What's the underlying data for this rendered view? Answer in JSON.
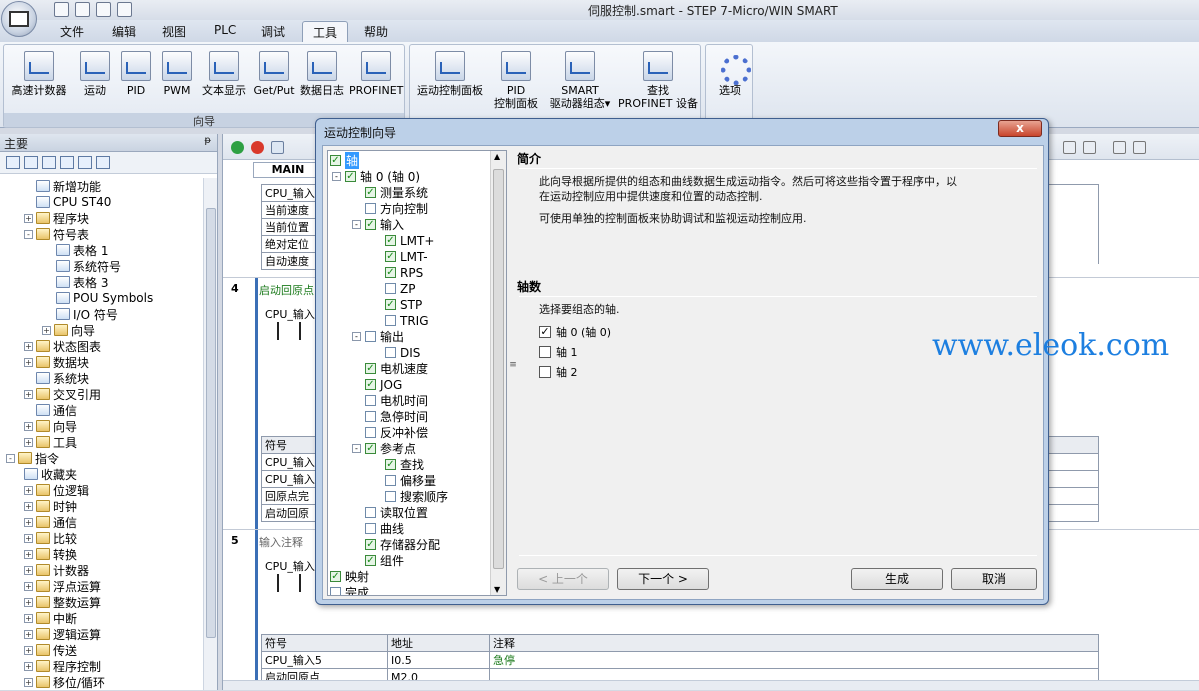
{
  "window": {
    "title": "伺服控制.smart - STEP 7-Micro/WIN SMART"
  },
  "menu": [
    "文件",
    "编辑",
    "视图",
    "PLC",
    "调试",
    "工具",
    "帮助"
  ],
  "ribbon": {
    "group_wizards_label": "向导",
    "wizards": [
      "高速计数器",
      "运动",
      "PID",
      "PWM",
      "文本显示",
      "Get/Put",
      "数据日志",
      "PROFINET"
    ],
    "tools": [
      {
        "l1": "运动控制面板",
        "l2": ""
      },
      {
        "l1": "PID",
        "l2": "控制面板"
      },
      {
        "l1": "SMART",
        "l2": "驱动器组态▾"
      },
      {
        "l1": "查找",
        "l2": "PROFINET 设备"
      }
    ],
    "options": "选项"
  },
  "left_pane": {
    "title": "主要",
    "tree": [
      {
        "label": "新增功能",
        "indent": 36,
        "pm": ""
      },
      {
        "label": "CPU ST40",
        "indent": 36,
        "pm": ""
      },
      {
        "label": "程序块",
        "indent": 24,
        "pm": "+"
      },
      {
        "label": "符号表",
        "indent": 24,
        "pm": "-"
      },
      {
        "label": "表格 1",
        "indent": 56,
        "pm": ""
      },
      {
        "label": "系统符号",
        "indent": 56,
        "pm": ""
      },
      {
        "label": "表格 3",
        "indent": 56,
        "pm": ""
      },
      {
        "label": "POU Symbols",
        "indent": 56,
        "pm": ""
      },
      {
        "label": "I/O 符号",
        "indent": 56,
        "pm": ""
      },
      {
        "label": "向导",
        "indent": 42,
        "pm": "+"
      },
      {
        "label": "状态图表",
        "indent": 24,
        "pm": "+"
      },
      {
        "label": "数据块",
        "indent": 24,
        "pm": "+"
      },
      {
        "label": "系统块",
        "indent": 36,
        "pm": ""
      },
      {
        "label": "交叉引用",
        "indent": 24,
        "pm": "+"
      },
      {
        "label": "通信",
        "indent": 36,
        "pm": ""
      },
      {
        "label": "向导",
        "indent": 24,
        "pm": "+"
      },
      {
        "label": "工具",
        "indent": 24,
        "pm": "+"
      },
      {
        "label": "指令",
        "indent": 6,
        "pm": "-"
      },
      {
        "label": "收藏夹",
        "indent": 24,
        "pm": ""
      },
      {
        "label": "位逻辑",
        "indent": 24,
        "pm": "+"
      },
      {
        "label": "时钟",
        "indent": 24,
        "pm": "+"
      },
      {
        "label": "通信",
        "indent": 24,
        "pm": "+"
      },
      {
        "label": "比较",
        "indent": 24,
        "pm": "+"
      },
      {
        "label": "转换",
        "indent": 24,
        "pm": "+"
      },
      {
        "label": "计数器",
        "indent": 24,
        "pm": "+"
      },
      {
        "label": "浮点运算",
        "indent": 24,
        "pm": "+"
      },
      {
        "label": "整数运算",
        "indent": 24,
        "pm": "+"
      },
      {
        "label": "中断",
        "indent": 24,
        "pm": "+"
      },
      {
        "label": "逻辑运算",
        "indent": 24,
        "pm": "+"
      },
      {
        "label": "传送",
        "indent": 24,
        "pm": "+"
      },
      {
        "label": "程序控制",
        "indent": 24,
        "pm": "+"
      },
      {
        "label": "移位/循环",
        "indent": 24,
        "pm": "+"
      }
    ]
  },
  "editor": {
    "tab": "MAIN",
    "rung3_symbols": [
      "CPU_输入",
      "当前速度",
      "当前位置",
      "绝对定位",
      "自动速度"
    ],
    "rung4": {
      "no": "4",
      "comment": "启动回原点",
      "contact": "CPU_输入"
    },
    "rung4_table": {
      "header": "符号",
      "rows": [
        "CPU_输入",
        "CPU_输入",
        "回原点完",
        "启动回原"
      ]
    },
    "rung5": {
      "no": "5",
      "comment": "输入注释",
      "contact": "CPU_输入"
    },
    "rung5_table": {
      "headers": [
        "符号",
        "地址",
        "注释"
      ],
      "rows": [
        [
          "CPU_输入5",
          "I0.5",
          "急停"
        ],
        [
          "启动回原点",
          "M2.0",
          ""
        ]
      ]
    }
  },
  "dialog": {
    "title": "运动控制向导",
    "close": "x",
    "tree": [
      {
        "label": "轴",
        "level": 0,
        "state": "on",
        "pm": "",
        "selected": true
      },
      {
        "label": "轴 0 (轴 0)",
        "level": 1,
        "state": "on",
        "pm": "-"
      },
      {
        "label": "测量系统",
        "level": 2,
        "state": "on",
        "pm": ""
      },
      {
        "label": "方向控制",
        "level": 2,
        "state": "off",
        "pm": ""
      },
      {
        "label": "输入",
        "level": 2,
        "state": "on",
        "pm": "-"
      },
      {
        "label": "LMT+",
        "level": 3,
        "state": "on",
        "pm": ""
      },
      {
        "label": "LMT-",
        "level": 3,
        "state": "on",
        "pm": ""
      },
      {
        "label": "RPS",
        "level": 3,
        "state": "on",
        "pm": ""
      },
      {
        "label": "ZP",
        "level": 3,
        "state": "off",
        "pm": ""
      },
      {
        "label": "STP",
        "level": 3,
        "state": "on",
        "pm": ""
      },
      {
        "label": "TRIG",
        "level": 3,
        "state": "off",
        "pm": ""
      },
      {
        "label": "输出",
        "level": 2,
        "state": "off",
        "pm": "-"
      },
      {
        "label": "DIS",
        "level": 3,
        "state": "off",
        "pm": ""
      },
      {
        "label": "电机速度",
        "level": 2,
        "state": "on",
        "pm": ""
      },
      {
        "label": "JOG",
        "level": 2,
        "state": "on",
        "pm": ""
      },
      {
        "label": "电机时间",
        "level": 2,
        "state": "off",
        "pm": ""
      },
      {
        "label": "急停时间",
        "level": 2,
        "state": "off",
        "pm": ""
      },
      {
        "label": "反冲补偿",
        "level": 2,
        "state": "off",
        "pm": ""
      },
      {
        "label": "参考点",
        "level": 2,
        "state": "on",
        "pm": "-"
      },
      {
        "label": "查找",
        "level": 3,
        "state": "on",
        "pm": ""
      },
      {
        "label": "偏移量",
        "level": 3,
        "state": "off",
        "pm": ""
      },
      {
        "label": "搜索顺序",
        "level": 3,
        "state": "off",
        "pm": ""
      },
      {
        "label": "读取位置",
        "level": 2,
        "state": "off",
        "pm": ""
      },
      {
        "label": "曲线",
        "level": 2,
        "state": "off",
        "pm": ""
      },
      {
        "label": "存储器分配",
        "level": 2,
        "state": "on",
        "pm": ""
      },
      {
        "label": "组件",
        "level": 2,
        "state": "on",
        "pm": ""
      },
      {
        "label": "映射",
        "level": 0,
        "state": "on",
        "pm": ""
      },
      {
        "label": "完成",
        "level": 0,
        "state": "off",
        "pm": ""
      }
    ],
    "intro_heading": "简介",
    "intro_line1": "此向导根据所提供的组态和曲线数据生成运动指令。然后可将这些指令置于程序中，以",
    "intro_line2": "在运动控制应用中提供速度和位置的动态控制.",
    "intro_line3": "可使用单独的控制面板来协助调试和监视运动控制应用.",
    "axes_heading": "轴数",
    "axes_prompt": "选择要组态的轴.",
    "axes": [
      {
        "label": "轴 0 (轴 0)",
        "checked": true
      },
      {
        "label": "轴 1",
        "checked": false
      },
      {
        "label": "轴 2",
        "checked": false
      }
    ],
    "buttons": {
      "prev": "< 上一个",
      "next": "下一个 >",
      "generate": "生成",
      "cancel": "取消"
    }
  },
  "watermark": "www.eleok.com"
}
